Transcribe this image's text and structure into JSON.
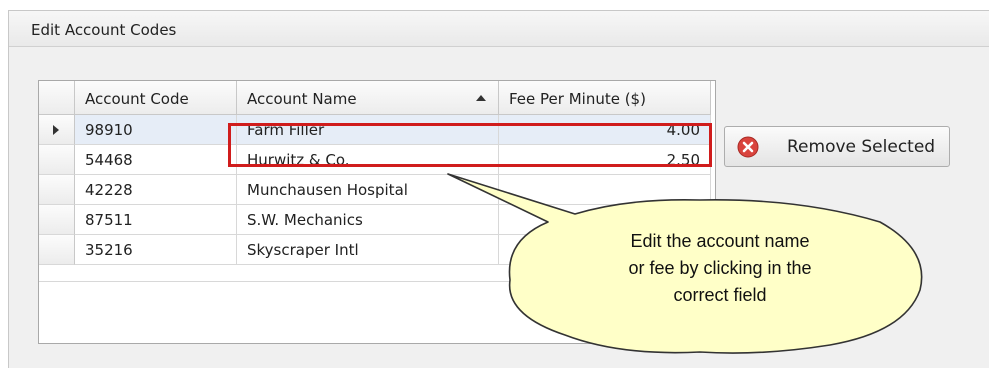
{
  "panel": {
    "title": "Edit Account Codes"
  },
  "grid": {
    "columns": [
      "Account Code",
      "Account Name",
      "Fee Per Minute ($)"
    ],
    "sort": {
      "column": "Account Name",
      "direction": "ascending"
    },
    "rows": [
      {
        "code": "98910",
        "name": "Farm Filler",
        "fee": "4.00",
        "selected": true
      },
      {
        "code": "54468",
        "name": "Hurwitz & Co.",
        "fee": "2.50",
        "selected": false
      },
      {
        "code": "42228",
        "name": "Munchausen Hospital",
        "fee": "",
        "selected": false
      },
      {
        "code": "87511",
        "name": "S.W. Mechanics",
        "fee": "",
        "selected": false
      },
      {
        "code": "35216",
        "name": "Skyscraper Intl",
        "fee": "",
        "selected": false
      }
    ]
  },
  "remove_button": {
    "label": "Remove Selected",
    "icon": "remove-x-icon"
  },
  "callout": {
    "lines": [
      "Edit the account name",
      "or fee by clicking in the",
      "correct field"
    ]
  },
  "colors": {
    "highlight": "#d01c1c",
    "callout_fill": "#ffffc8",
    "remove_icon": "#d9443e"
  }
}
